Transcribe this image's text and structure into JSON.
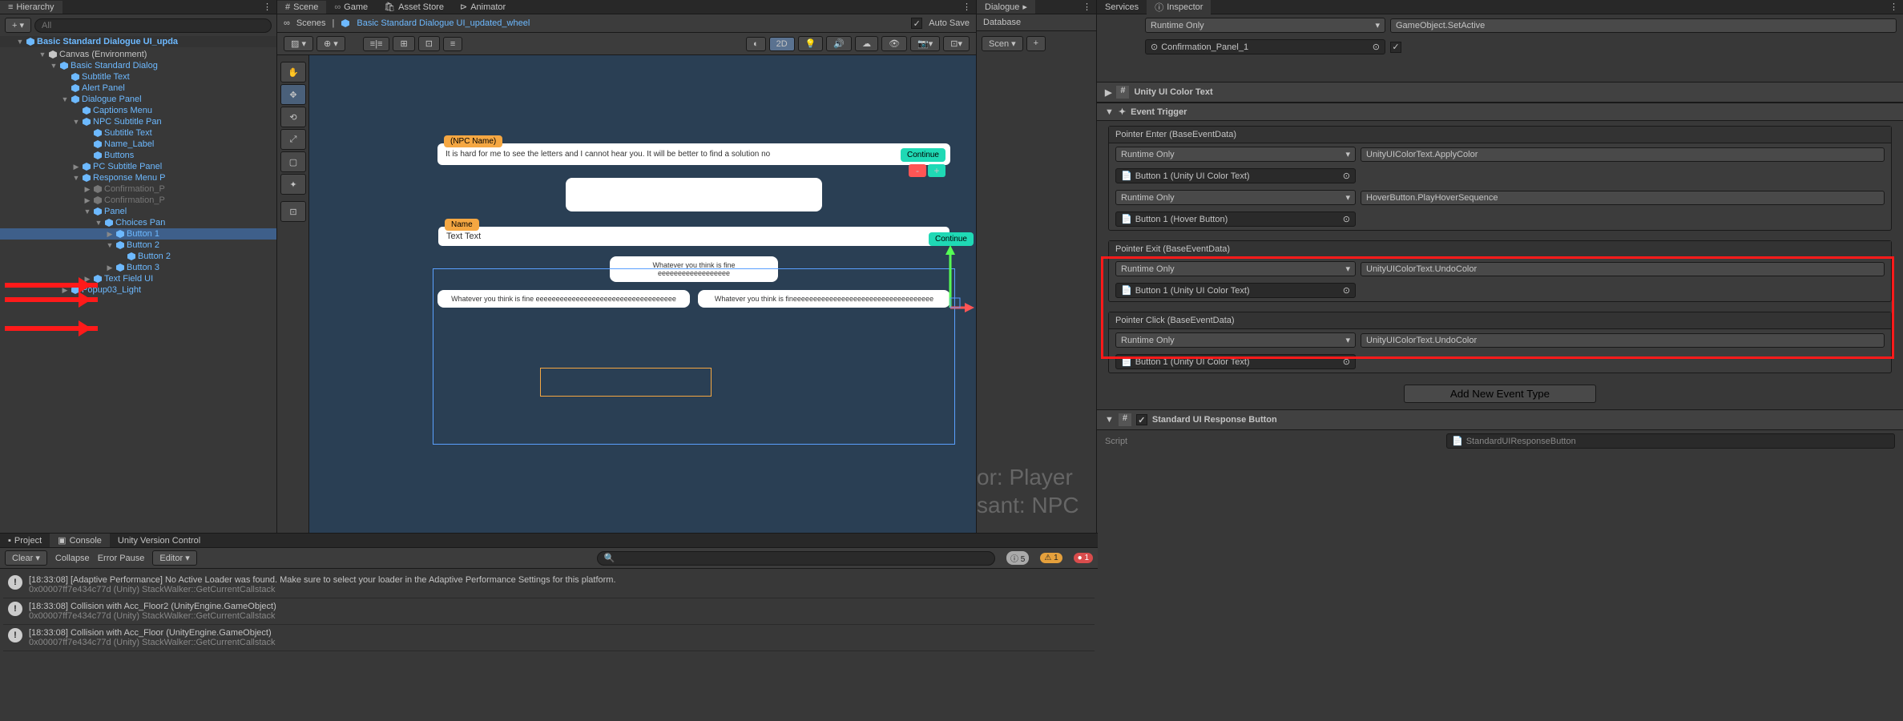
{
  "tabs_top": {
    "hierarchy": "Hierarchy",
    "scene": "Scene",
    "game": "Game",
    "asset_store": "Asset Store",
    "animator": "Animator",
    "dialogue": "Dialogue",
    "services": "Services",
    "inspector": "Inspector"
  },
  "hierarchy": {
    "search_placeholder": "All",
    "root": "Basic Standard Dialogue UI_upda",
    "items": [
      {
        "label": "Canvas (Environment)",
        "indent": 3,
        "arrow": "▼",
        "prefab": false
      },
      {
        "label": "Basic Standard Dialog",
        "indent": 4,
        "arrow": "▼",
        "prefab": true
      },
      {
        "label": "Subtitle Text",
        "indent": 5,
        "arrow": "",
        "prefab": true
      },
      {
        "label": "Alert Panel",
        "indent": 5,
        "arrow": "",
        "prefab": true
      },
      {
        "label": "Dialogue Panel",
        "indent": 5,
        "arrow": "▼",
        "prefab": true
      },
      {
        "label": "Captions Menu",
        "indent": 6,
        "arrow": "",
        "prefab": true
      },
      {
        "label": "NPC Subtitle Pan",
        "indent": 6,
        "arrow": "▼",
        "prefab": true
      },
      {
        "label": "Subtitle Text",
        "indent": 7,
        "arrow": "",
        "prefab": true
      },
      {
        "label": "Name_Label",
        "indent": 7,
        "arrow": "",
        "prefab": true
      },
      {
        "label": "Buttons",
        "indent": 7,
        "arrow": "",
        "prefab": true
      },
      {
        "label": "PC Subtitle Panel",
        "indent": 6,
        "arrow": "▶",
        "prefab": true
      },
      {
        "label": "Response Menu P",
        "indent": 6,
        "arrow": "▼",
        "prefab": true
      },
      {
        "label": "Confirmation_P",
        "indent": 7,
        "arrow": "▶",
        "prefab": false,
        "dim": true
      },
      {
        "label": "Confirmation_P",
        "indent": 7,
        "arrow": "▶",
        "prefab": false,
        "dim": true
      },
      {
        "label": "Panel",
        "indent": 7,
        "arrow": "▼",
        "prefab": true
      },
      {
        "label": "Choices Pan",
        "indent": 8,
        "arrow": "▼",
        "prefab": true
      },
      {
        "label": "Button 1",
        "indent": 9,
        "arrow": "▶",
        "prefab": true,
        "selected": true,
        "red_arrow": true
      },
      {
        "label": "Button 2",
        "indent": 9,
        "arrow": "▼",
        "prefab": true,
        "red_arrow": true
      },
      {
        "label": "Button 2",
        "indent": 10,
        "arrow": "",
        "prefab": true
      },
      {
        "label": "Button 3",
        "indent": 9,
        "arrow": "▶",
        "prefab": true,
        "red_arrow": true
      },
      {
        "label": "Text Field UI",
        "indent": 7,
        "arrow": "▶",
        "prefab": true
      },
      {
        "label": "Popup03_Light",
        "indent": 5,
        "arrow": "▶",
        "prefab": true
      }
    ]
  },
  "scene": {
    "breadcrumb_scenes": "Scenes",
    "breadcrumb_asset": "Basic Standard Dialogue UI_updated_wheel",
    "auto_save": "Auto Save",
    "mode_2d": "2D",
    "npc_name": "(NPC Name)",
    "npc_dialogue": "It is hard for me to see the letters and I cannot hear you. It will be better to find a solution no",
    "continue": "Continue",
    "name_label": "Name",
    "text_text": "Text Text",
    "choice1": "Whatever you think is fine eeeeeeeeeeeeeeeeee",
    "choice2": "Whatever you think is fine eeeeeeeeeeeeeeeeeeeeeeeeeeeeeeeeeee",
    "choice3": "Whatever you think is fineeeeeeeeeeeeeeeeeeeeeeeeeeeeeeeeeee"
  },
  "middle": {
    "database": "Database",
    "scen_btn": "Scen",
    "faded1": "or: Player",
    "faded2": "sant: NPC"
  },
  "inspector": {
    "runtime_only": "Runtime Only",
    "setactive": "GameObject.SetActive",
    "confirmation": "Confirmation_Panel_1",
    "unity_color": "Unity UI Color Text",
    "event_trigger": "Event Trigger",
    "pointer_enter": "Pointer Enter (BaseEventData)",
    "apply_color": "UnityUIColorText.ApplyColor",
    "button1_color": "Button 1 (Unity UI Color Text)",
    "hover_seq": "HoverButton.PlayHoverSequence",
    "button1_hover": "Button 1 (Hover Button)",
    "pointer_exit": "Pointer Exit (BaseEventData)",
    "undo_color": "UnityUIColorText.UndoColor",
    "pointer_click": "Pointer Click (BaseEventData)",
    "add_new": "Add New Event Type",
    "std_response": "Standard UI Response Button",
    "script_label": "Script",
    "script_value": "StandardUIResponseButton"
  },
  "console": {
    "project": "Project",
    "console": "Console",
    "uvc": "Unity Version Control",
    "clear": "Clear",
    "collapse": "Collapse",
    "error_pause": "Error Pause",
    "editor": "Editor",
    "info_count": "5",
    "warn_count": "1",
    "err_count": "1",
    "logs": [
      {
        "t": "[18:33:08] [Adaptive Performance] No Active Loader was found. Make sure to select your loader in the Adaptive Performance Settings for this platform.",
        "s": "0x00007ff7e434c77d (Unity) StackWalker::GetCurrentCallstack"
      },
      {
        "t": "[18:33:08] Collision with Acc_Floor2 (UnityEngine.GameObject)",
        "s": "0x00007ff7e434c77d (Unity) StackWalker::GetCurrentCallstack"
      },
      {
        "t": "[18:33:08] Collision with Acc_Floor (UnityEngine.GameObject)",
        "s": "0x00007ff7e434c77d (Unity) StackWalker::GetCurrentCallstack"
      }
    ]
  }
}
